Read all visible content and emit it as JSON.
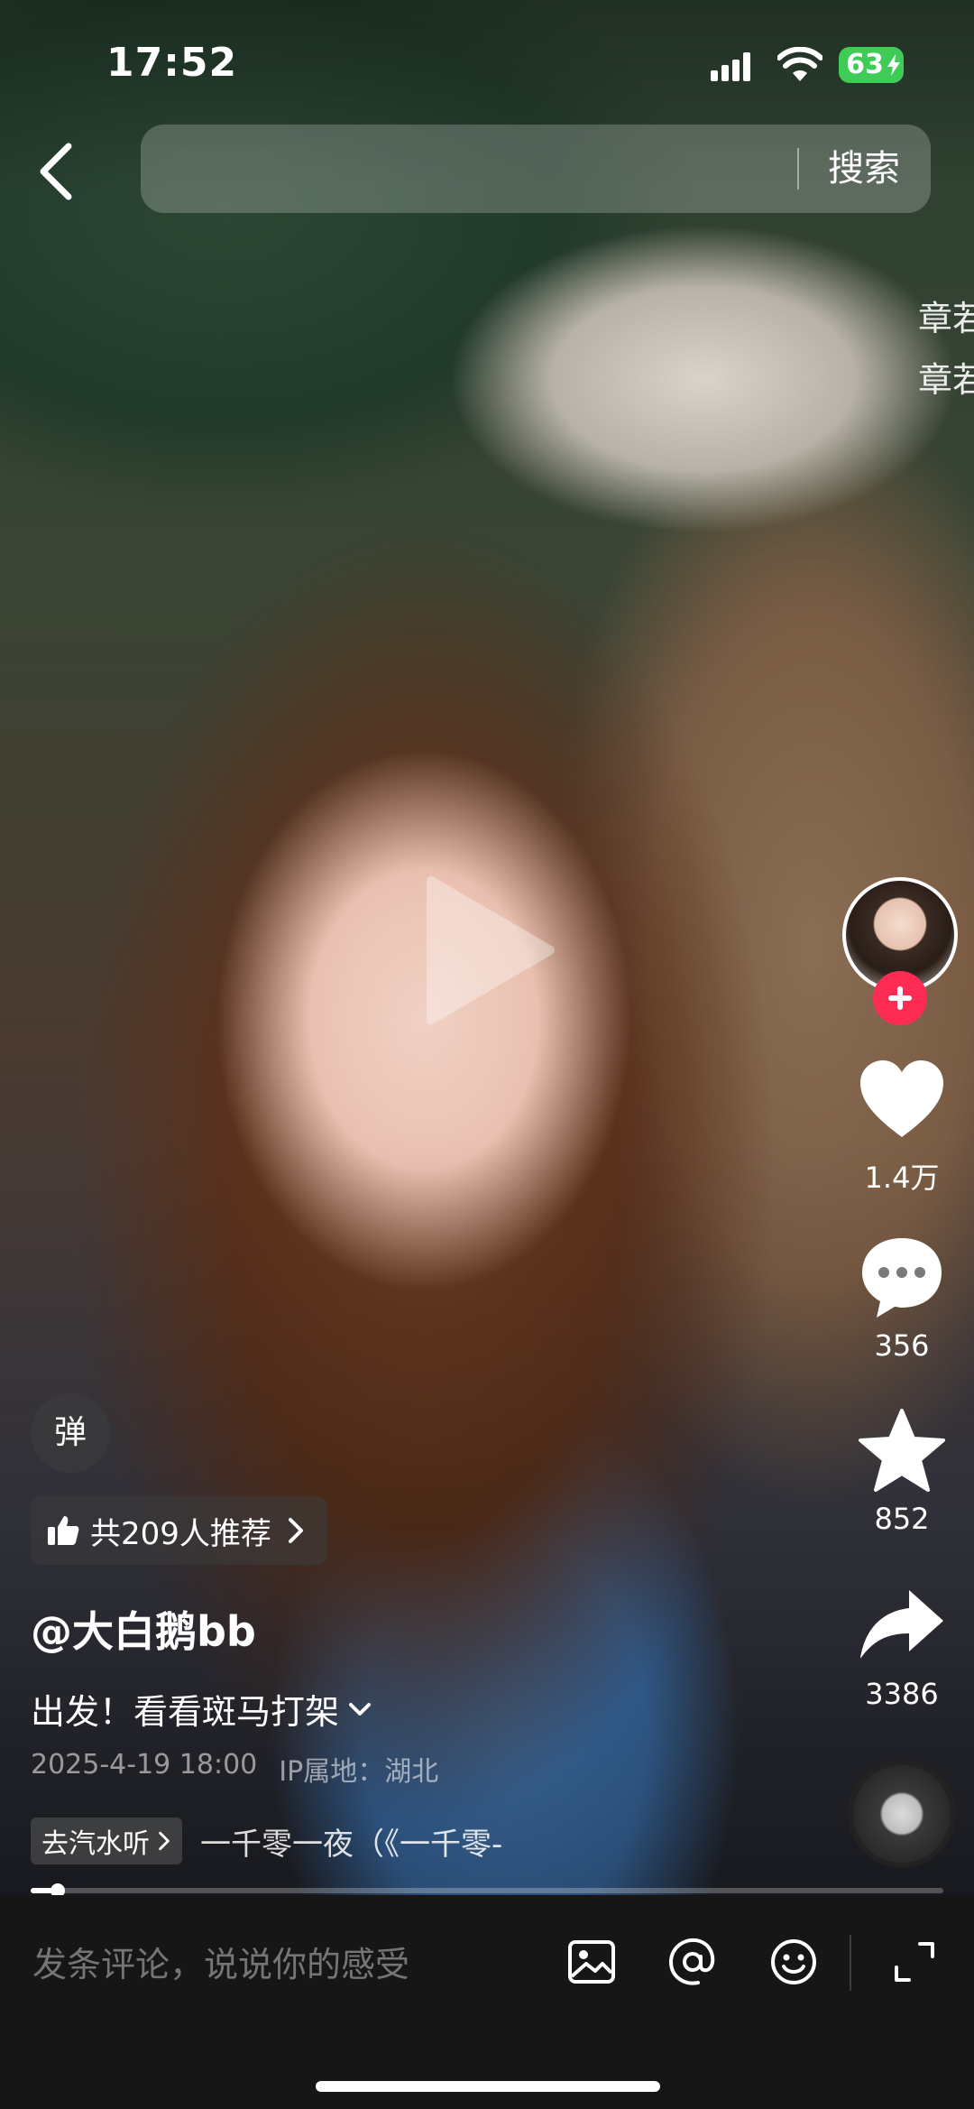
{
  "status_bar": {
    "time": "17:52",
    "battery": "63"
  },
  "search": {
    "button_label": "搜索",
    "placeholder": ""
  },
  "side_overlay": {
    "line1": "章若",
    "line2": "章若"
  },
  "actions": {
    "like_count": "1.4万",
    "comment_count": "356",
    "favorite_count": "852",
    "share_count": "3386"
  },
  "danmaku": {
    "label": "弹"
  },
  "recommend": {
    "text": "共209人推荐"
  },
  "post": {
    "author": "@大白鹅bb",
    "caption": "出发！看看斑马打架",
    "date": "2025-4-19 18:00",
    "ip_location": "IP属地：湖北"
  },
  "music": {
    "tag_label": "去汽水听",
    "title": "一千零一夜（《一千零-"
  },
  "playback": {
    "progress_fraction": 0.03
  },
  "comment_bar": {
    "placeholder": "发条评论，说说你的感受"
  },
  "colors": {
    "follow_accent": "#fe2c55",
    "battery_green": "#3ecb56",
    "bottom_bar": "#161616"
  }
}
